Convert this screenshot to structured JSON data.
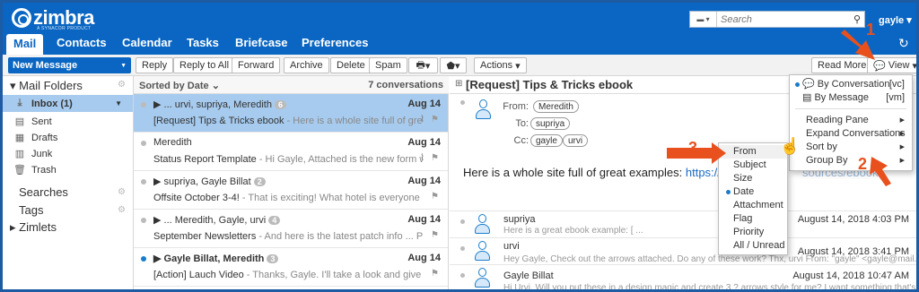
{
  "app": {
    "logo_text": "zimbra",
    "logo_sub": "A SYNACOR PRODUCT"
  },
  "search": {
    "placeholder": "Search"
  },
  "user": {
    "name": "gayle"
  },
  "tabs": [
    "Mail",
    "Contacts",
    "Calendar",
    "Tasks",
    "Briefcase",
    "Preferences"
  ],
  "toolbar": {
    "new_message": "New Message",
    "reply": "Reply",
    "reply_all": "Reply to All",
    "forward": "Forward",
    "archive": "Archive",
    "delete": "Delete",
    "spam": "Spam",
    "actions": "Actions",
    "read_more": "Read More",
    "view": "View"
  },
  "sidebar": {
    "mail_folders": "Mail Folders",
    "folders": [
      {
        "name": "Inbox (1)",
        "icon": "inbox-icon"
      },
      {
        "name": "Sent",
        "icon": "sent-icon"
      },
      {
        "name": "Drafts",
        "icon": "drafts-icon"
      },
      {
        "name": "Junk",
        "icon": "junk-icon"
      },
      {
        "name": "Trash",
        "icon": "trash-icon"
      }
    ],
    "searches": "Searches",
    "tags": "Tags",
    "zimlets": "Zimlets"
  },
  "list": {
    "sorted_by": "Sorted by Date",
    "count": "7 conversations",
    "rows": [
      {
        "from": "▶ ... urvi, supriya, Meredith",
        "count": "6",
        "date": "Aug 14",
        "subject": "[Request] Tips & Tricks ebook",
        "fragment": " - Here is a whole site full of great e:",
        "unread": false,
        "selected": true
      },
      {
        "from": "Meredith",
        "count": "",
        "date": "Aug 14",
        "subject": "Status Report Template",
        "fragment": " - Hi Gayle, Attached is the new form we wi",
        "unread": false,
        "selected": false
      },
      {
        "from": "▶ supriya, Gayle Billat",
        "count": "2",
        "date": "Aug 14",
        "subject": "Offsite October 3-4!",
        "fragment": " - That is exciting! What hotel is everyone staying i",
        "unread": false,
        "selected": false
      },
      {
        "from": "▶ ... Meredith, Gayle, urvi",
        "count": "4",
        "date": "Aug 14",
        "subject": "September Newsletters",
        "fragment": " - And here is the latest patch info ... Patch Info",
        "unread": false,
        "selected": false
      },
      {
        "from": "▶ Gayle Billat, Meredith",
        "count": "3",
        "date": "Aug 14",
        "subject": "[Action] Lauch Video",
        "fragment": " - Thanks, Gayle. I'll take a look and give you fee",
        "unread": true,
        "selected": false
      }
    ]
  },
  "reading": {
    "title": "[Request] Tips & Tricks ebook",
    "from_label": "From:",
    "to_label": "To:",
    "cc_label": "Cc:",
    "from": "Meredith",
    "to": "supriya",
    "cc": [
      "gayle",
      "urvi"
    ],
    "body": "Here is a whole site full of great examples:",
    "link": "https://www.",
    "link_tail": "sources/ebook",
    "replies": [
      {
        "name": "supriya",
        "preview": "Here is a great ebook example: [ ...",
        "date": "August 14, 2018 4:03 PM"
      },
      {
        "name": "urvi",
        "preview": "Hey Gayle, Check out the arrows attached. Do any of these work? Thx, urvi From: \"gayle\" <gayle@mail.zimb",
        "date": "August 14, 2018 3:41 PM"
      },
      {
        "name": "Gayle Billat",
        "preview": "Hi Urvi, Will you put these in a design magic and create 3 ? arrows style for me? I want something that's hot an",
        "date": "August 14, 2018 10:47 AM"
      }
    ]
  },
  "view_menu": {
    "items": [
      {
        "label": "By Conversation",
        "key": "[vc]"
      },
      {
        "label": "By Message",
        "key": "[vm]"
      },
      {
        "label": "Reading Pane",
        "key": ""
      },
      {
        "label": "Expand Conversations",
        "key": ""
      },
      {
        "label": "Sort by",
        "key": ""
      },
      {
        "label": "Group By",
        "key": ""
      }
    ]
  },
  "sort_menu": {
    "items": [
      "From",
      "Subject",
      "Size",
      "Date",
      "Attachment",
      "Flag",
      "Priority",
      "All / Unread"
    ]
  },
  "annotations": [
    "1",
    "2",
    "3"
  ],
  "colors": {
    "brand": "#0a66c2",
    "selection": "#a7cbee",
    "arrow": "#e8501d"
  }
}
